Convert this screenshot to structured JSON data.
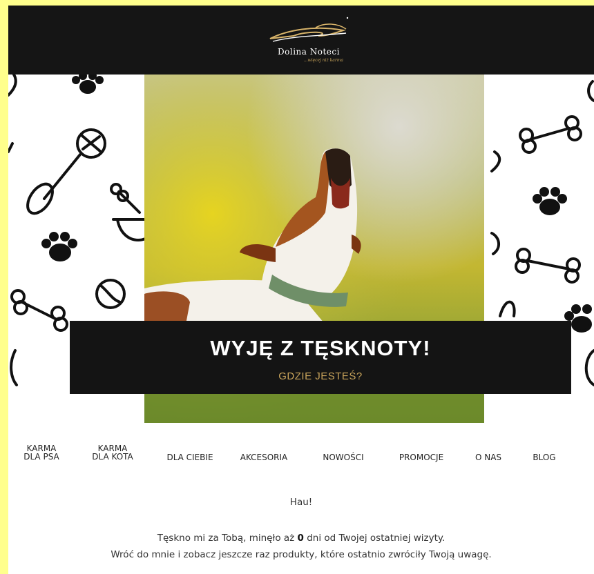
{
  "brand": {
    "name": "Dolina Noteci",
    "tagline": "...więcej niż karma"
  },
  "hero": {
    "title": "WYJĘ Z TĘSKNOTY!",
    "subtitle": "GDZIE JESTEŚ?"
  },
  "nav": {
    "items": [
      {
        "label": "KARMA\nDLA PSA"
      },
      {
        "label": "KARMA\nDLA KOTA"
      },
      {
        "label": "DLA CIEBIE"
      },
      {
        "label": "AKCESORIA"
      },
      {
        "label": "NOWOŚCI"
      },
      {
        "label": "PROMOCJE"
      },
      {
        "label": "O NAS"
      },
      {
        "label": "BLOG"
      }
    ]
  },
  "content": {
    "greeting": "Hau!",
    "line1_before": "Tęskno mi za Tobą, minęło aż ",
    "days_count": "0",
    "line1_after": " dni od Twojej ostatniej wizyty.",
    "line2": "Wróć do mnie i zobacz jeszcze raz produkty, które ostatnio zwróciły Twoją uwagę."
  },
  "colors": {
    "page_background": "#ffff8c",
    "header_background": "#151515",
    "accent_gold": "#c9a45b"
  },
  "icons": [
    "paw-icon",
    "rope-toy-icon",
    "bone-icon",
    "dog-bowl-icon",
    "ball-icon"
  ]
}
